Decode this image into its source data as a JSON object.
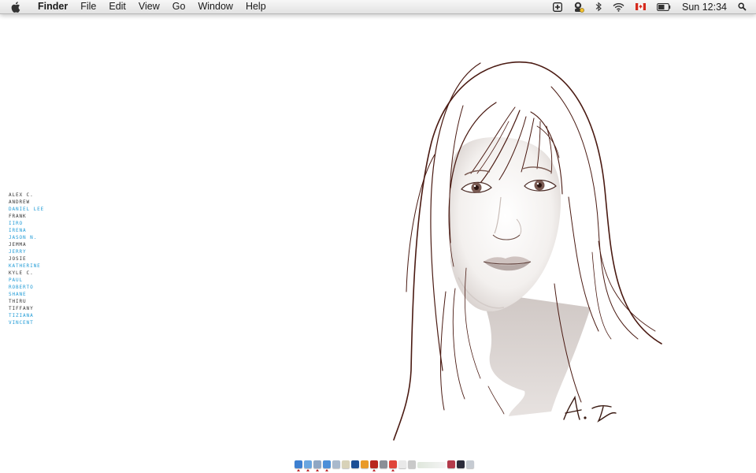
{
  "menubar": {
    "app_name": "Finder",
    "menus": [
      "File",
      "Edit",
      "View",
      "Go",
      "Window",
      "Help"
    ],
    "status_icons": [
      "add-square-icon",
      "user-status-icon",
      "bluetooth-icon",
      "wifi-icon",
      "canada-flag-icon",
      "battery-icon"
    ],
    "clock": "Sun 12:34",
    "spotlight_icon": "spotlight-search-icon"
  },
  "desktop": {
    "names": [
      {
        "text": "Alex C.",
        "color": "#333333"
      },
      {
        "text": "Andrew",
        "color": "#333333"
      },
      {
        "text": "Daniel Lee",
        "color": "#1e9ad6"
      },
      {
        "text": "Frank",
        "color": "#333333"
      },
      {
        "text": "Iiro",
        "color": "#1e9ad6"
      },
      {
        "text": "Irena",
        "color": "#1e9ad6"
      },
      {
        "text": "Jason N.",
        "color": "#1e9ad6"
      },
      {
        "text": "Jemma",
        "color": "#333333"
      },
      {
        "text": "Jerry",
        "color": "#1e9ad6"
      },
      {
        "text": "Josie",
        "color": "#333333"
      },
      {
        "text": "Katherine",
        "color": "#1e9ad6"
      },
      {
        "text": "Kyle C.",
        "color": "#333333"
      },
      {
        "text": "Paul",
        "color": "#1e9ad6"
      },
      {
        "text": "Roberto",
        "color": "#1e9ad6"
      },
      {
        "text": "Shane",
        "color": "#1e9ad6"
      },
      {
        "text": "Thiru",
        "color": "#333333"
      },
      {
        "text": "Tiffany",
        "color": "#333333"
      },
      {
        "text": "Tiziana",
        "color": "#1e9ad6"
      },
      {
        "text": "Vincent",
        "color": "#1e9ad6"
      }
    ],
    "wallpaper": "line-drawing-portrait"
  },
  "dock": {
    "icons": [
      {
        "name": "finder-icon",
        "color": "#3d7fd0",
        "running": true
      },
      {
        "name": "safari-icon",
        "color": "#6aa6e0",
        "running": true
      },
      {
        "name": "mail-icon",
        "color": "#8fa7c4",
        "running": true
      },
      {
        "name": "itunes-icon",
        "color": "#4c8fd8",
        "running": true
      },
      {
        "name": "preview-icon",
        "color": "#a9b9cc",
        "running": false
      },
      {
        "name": "notes-icon",
        "color": "#d8d2b8",
        "running": false
      },
      {
        "name": "photoshop-icon",
        "color": "#1c4f96",
        "running": false
      },
      {
        "name": "illustrator-icon",
        "color": "#e89a2a",
        "running": false
      },
      {
        "name": "acrobat-icon",
        "color": "#b8261e",
        "running": true
      },
      {
        "name": "system-preferences-icon",
        "color": "#8a8f96",
        "running": false
      },
      {
        "name": "chat-icon",
        "color": "#e0453a",
        "running": true
      },
      {
        "name": "calendar-icon",
        "color": "#e9e9e9",
        "running": false
      },
      {
        "name": "textedit-icon",
        "color": "#c9c9c9",
        "running": false
      },
      {
        "name": "spacer-icon",
        "color": "#eeeeee",
        "running": false
      },
      {
        "name": "photos-icon",
        "color": "#b33a4a",
        "running": false
      },
      {
        "name": "documents-icon",
        "color": "#2b2b3a",
        "running": false
      },
      {
        "name": "trash-icon",
        "color": "#c6cbd2",
        "running": false
      }
    ]
  }
}
